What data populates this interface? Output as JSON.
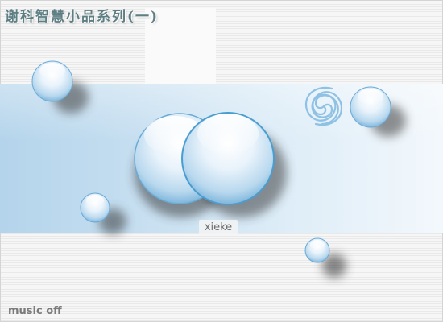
{
  "title": {
    "text": "谢科智慧小品系列(一)"
  },
  "caption": {
    "text": "xieke"
  },
  "music": {
    "toggle_label": "music off"
  },
  "icons": {
    "spiral": "spiral-icon",
    "bubble": "bubble-icon"
  },
  "colors": {
    "title_text": "#5d7e83",
    "band_left": "#b4d4eb",
    "band_right": "#f3f8fc",
    "bubble_highlight": "#ffffff",
    "bubble_body": "#9fcbe8",
    "bubble_edge": "#4a9dd0",
    "music_text": "#7a7a7a"
  }
}
